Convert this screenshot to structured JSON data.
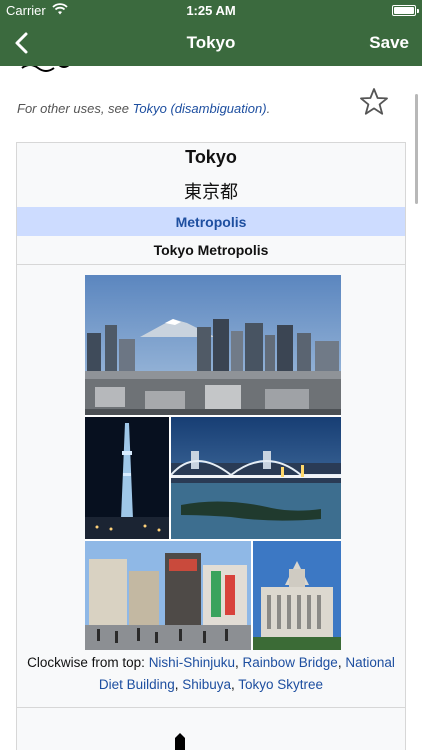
{
  "status_bar": {
    "carrier": "Carrier",
    "time": "1:25 AM"
  },
  "nav": {
    "title": "Tokyo",
    "save_label": "Save",
    "back_icon": "chevron-left-icon"
  },
  "article": {
    "hatnote_prefix": "For other uses, see ",
    "hatnote_link": "Tokyo (disambiguation)",
    "hatnote_suffix": "."
  },
  "infobox": {
    "name": "Tokyo",
    "native_name": "東京都",
    "type": "Metropolis",
    "official_name": "Tokyo Metropolis",
    "caption": {
      "prefix": "Clockwise from top: ",
      "link1": "Nishi-Shinjuku",
      "sep1": ", ",
      "link2": "Rainbow Bridge",
      "sep2": ", ",
      "link3": "National Diet Building",
      "sep3": ", ",
      "link4": "Shibuya",
      "sep4": ", ",
      "link5": "Tokyo Skytree"
    }
  },
  "colors": {
    "nav_green": "#3b6a3e",
    "link_blue": "#1e4fa0",
    "infobox_header": "#cddcff"
  }
}
